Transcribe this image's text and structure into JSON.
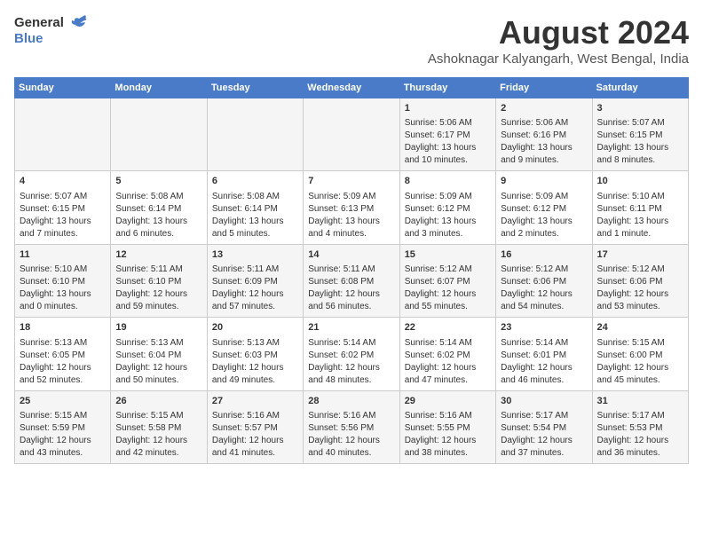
{
  "header": {
    "logo_general": "General",
    "logo_blue": "Blue",
    "title": "August 2024",
    "location": "Ashoknagar Kalyangarh, West Bengal, India"
  },
  "weekdays": [
    "Sunday",
    "Monday",
    "Tuesday",
    "Wednesday",
    "Thursday",
    "Friday",
    "Saturday"
  ],
  "weeks": [
    [
      {
        "day": "",
        "content": ""
      },
      {
        "day": "",
        "content": ""
      },
      {
        "day": "",
        "content": ""
      },
      {
        "day": "",
        "content": ""
      },
      {
        "day": "1",
        "content": "Sunrise: 5:06 AM\nSunset: 6:17 PM\nDaylight: 13 hours\nand 10 minutes."
      },
      {
        "day": "2",
        "content": "Sunrise: 5:06 AM\nSunset: 6:16 PM\nDaylight: 13 hours\nand 9 minutes."
      },
      {
        "day": "3",
        "content": "Sunrise: 5:07 AM\nSunset: 6:15 PM\nDaylight: 13 hours\nand 8 minutes."
      }
    ],
    [
      {
        "day": "4",
        "content": "Sunrise: 5:07 AM\nSunset: 6:15 PM\nDaylight: 13 hours\nand 7 minutes."
      },
      {
        "day": "5",
        "content": "Sunrise: 5:08 AM\nSunset: 6:14 PM\nDaylight: 13 hours\nand 6 minutes."
      },
      {
        "day": "6",
        "content": "Sunrise: 5:08 AM\nSunset: 6:14 PM\nDaylight: 13 hours\nand 5 minutes."
      },
      {
        "day": "7",
        "content": "Sunrise: 5:09 AM\nSunset: 6:13 PM\nDaylight: 13 hours\nand 4 minutes."
      },
      {
        "day": "8",
        "content": "Sunrise: 5:09 AM\nSunset: 6:12 PM\nDaylight: 13 hours\nand 3 minutes."
      },
      {
        "day": "9",
        "content": "Sunrise: 5:09 AM\nSunset: 6:12 PM\nDaylight: 13 hours\nand 2 minutes."
      },
      {
        "day": "10",
        "content": "Sunrise: 5:10 AM\nSunset: 6:11 PM\nDaylight: 13 hours\nand 1 minute."
      }
    ],
    [
      {
        "day": "11",
        "content": "Sunrise: 5:10 AM\nSunset: 6:10 PM\nDaylight: 13 hours\nand 0 minutes."
      },
      {
        "day": "12",
        "content": "Sunrise: 5:11 AM\nSunset: 6:10 PM\nDaylight: 12 hours\nand 59 minutes."
      },
      {
        "day": "13",
        "content": "Sunrise: 5:11 AM\nSunset: 6:09 PM\nDaylight: 12 hours\nand 57 minutes."
      },
      {
        "day": "14",
        "content": "Sunrise: 5:11 AM\nSunset: 6:08 PM\nDaylight: 12 hours\nand 56 minutes."
      },
      {
        "day": "15",
        "content": "Sunrise: 5:12 AM\nSunset: 6:07 PM\nDaylight: 12 hours\nand 55 minutes."
      },
      {
        "day": "16",
        "content": "Sunrise: 5:12 AM\nSunset: 6:06 PM\nDaylight: 12 hours\nand 54 minutes."
      },
      {
        "day": "17",
        "content": "Sunrise: 5:12 AM\nSunset: 6:06 PM\nDaylight: 12 hours\nand 53 minutes."
      }
    ],
    [
      {
        "day": "18",
        "content": "Sunrise: 5:13 AM\nSunset: 6:05 PM\nDaylight: 12 hours\nand 52 minutes."
      },
      {
        "day": "19",
        "content": "Sunrise: 5:13 AM\nSunset: 6:04 PM\nDaylight: 12 hours\nand 50 minutes."
      },
      {
        "day": "20",
        "content": "Sunrise: 5:13 AM\nSunset: 6:03 PM\nDaylight: 12 hours\nand 49 minutes."
      },
      {
        "day": "21",
        "content": "Sunrise: 5:14 AM\nSunset: 6:02 PM\nDaylight: 12 hours\nand 48 minutes."
      },
      {
        "day": "22",
        "content": "Sunrise: 5:14 AM\nSunset: 6:02 PM\nDaylight: 12 hours\nand 47 minutes."
      },
      {
        "day": "23",
        "content": "Sunrise: 5:14 AM\nSunset: 6:01 PM\nDaylight: 12 hours\nand 46 minutes."
      },
      {
        "day": "24",
        "content": "Sunrise: 5:15 AM\nSunset: 6:00 PM\nDaylight: 12 hours\nand 45 minutes."
      }
    ],
    [
      {
        "day": "25",
        "content": "Sunrise: 5:15 AM\nSunset: 5:59 PM\nDaylight: 12 hours\nand 43 minutes."
      },
      {
        "day": "26",
        "content": "Sunrise: 5:15 AM\nSunset: 5:58 PM\nDaylight: 12 hours\nand 42 minutes."
      },
      {
        "day": "27",
        "content": "Sunrise: 5:16 AM\nSunset: 5:57 PM\nDaylight: 12 hours\nand 41 minutes."
      },
      {
        "day": "28",
        "content": "Sunrise: 5:16 AM\nSunset: 5:56 PM\nDaylight: 12 hours\nand 40 minutes."
      },
      {
        "day": "29",
        "content": "Sunrise: 5:16 AM\nSunset: 5:55 PM\nDaylight: 12 hours\nand 38 minutes."
      },
      {
        "day": "30",
        "content": "Sunrise: 5:17 AM\nSunset: 5:54 PM\nDaylight: 12 hours\nand 37 minutes."
      },
      {
        "day": "31",
        "content": "Sunrise: 5:17 AM\nSunset: 5:53 PM\nDaylight: 12 hours\nand 36 minutes."
      }
    ]
  ]
}
